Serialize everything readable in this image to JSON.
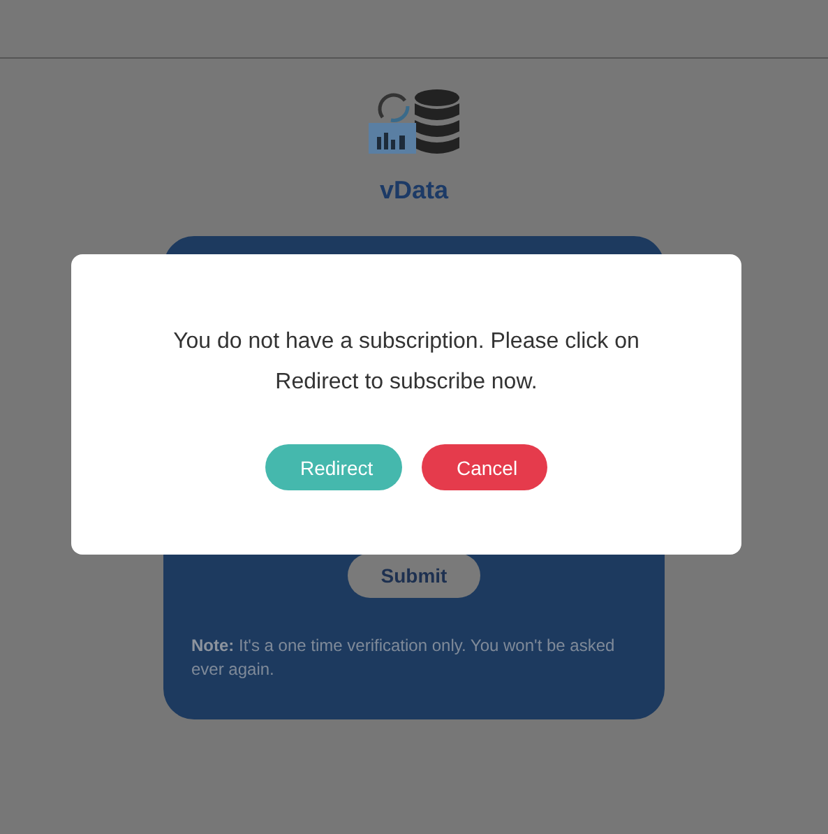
{
  "app": {
    "name": "vData"
  },
  "card": {
    "submit_label": "Submit",
    "note": "**Note:** It's a one time verification only. You won't be asked ever again."
  },
  "dialog": {
    "message": "You do not have a subscription. Please click on Redirect to subscribe now.",
    "buttons": [
      {
        "label": "Redirect",
        "kind": "primary"
      },
      {
        "label": "Cancel",
        "kind": "danger"
      }
    ]
  }
}
